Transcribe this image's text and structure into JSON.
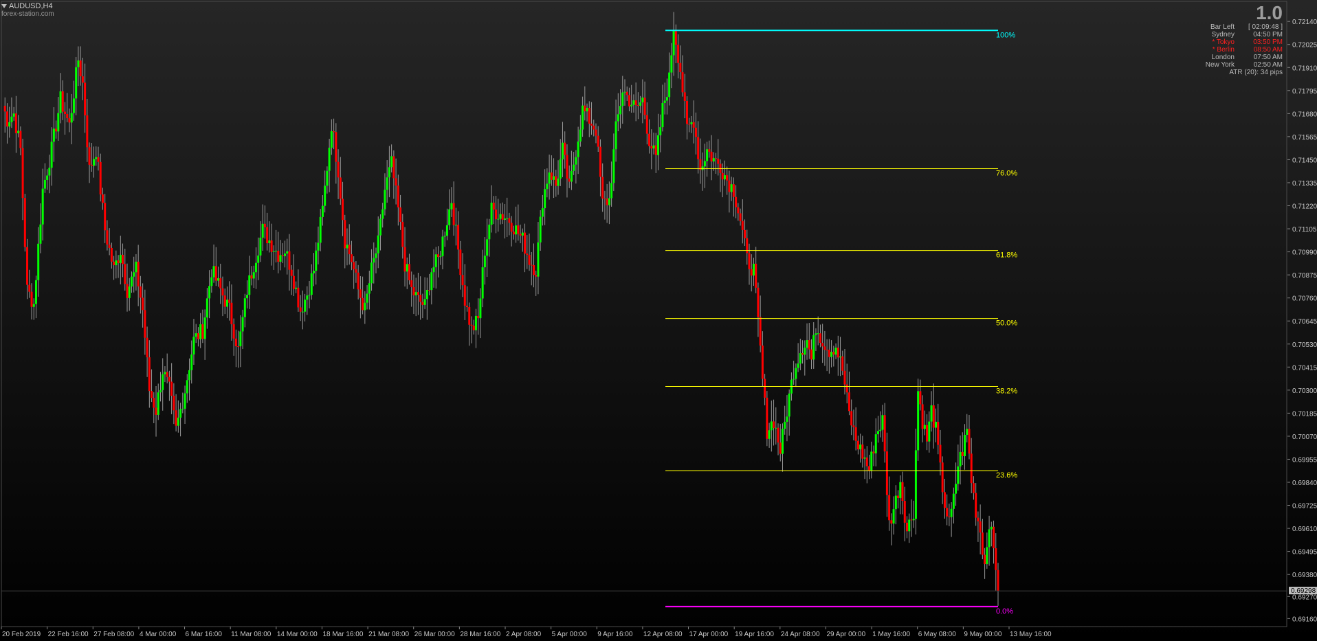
{
  "header": {
    "symbol": "AUDUSD,H4",
    "site": "forex-station.com"
  },
  "info_panel": {
    "big_value": "1.0",
    "rows": [
      {
        "name": "Bar Left",
        "value": "[ 02:09:48 ]",
        "highlight": false
      },
      {
        "name": "Sydney",
        "value": "04:50 PM",
        "highlight": false
      },
      {
        "name": "* Tokyo",
        "value": "03:50 PM",
        "highlight": true
      },
      {
        "name": "* Berlin",
        "value": "08:50 AM",
        "highlight": true
      },
      {
        "name": "London",
        "value": "07:50 AM",
        "highlight": false
      },
      {
        "name": "New York",
        "value": "02:50 AM",
        "highlight": false
      }
    ],
    "atr": "ATR (20): 34 pips"
  },
  "colors": {
    "bull": "#00ff00",
    "bear": "#ff0000",
    "wick": "#9a9a9a",
    "fib_top": "#00ffff",
    "fib_mid": "#ffff00",
    "fib_bottom": "#ff00ff",
    "axis_text": "#c8c8c8",
    "current_price_box": "#c0c0c0"
  },
  "chart_data": {
    "type": "candlestick",
    "symbol": "AUDUSD",
    "timeframe": "H4",
    "ylim": [
      0.6912,
      0.7224
    ],
    "y_ticks": [
      "0.72140",
      "0.72025",
      "0.71910",
      "0.71795",
      "0.71680",
      "0.71565",
      "0.71450",
      "0.71335",
      "0.71220",
      "0.71105",
      "0.70990",
      "0.70875",
      "0.70760",
      "0.70645",
      "0.70530",
      "0.70415",
      "0.70300",
      "0.70185",
      "0.70070",
      "0.69955",
      "0.69840",
      "0.69725",
      "0.69610",
      "0.69495",
      "0.69380",
      "0.69270",
      "0.69160"
    ],
    "x_ticks": [
      "20 Feb 2019",
      "22 Feb 16:00",
      "27 Feb 08:00",
      "4 Mar 00:00",
      "6 Mar 16:00",
      "11 Mar 08:00",
      "14 Mar 00:00",
      "18 Mar 16:00",
      "21 Mar 08:00",
      "26 Mar 00:00",
      "28 Mar 16:00",
      "2 Apr 08:00",
      "5 Apr 00:00",
      "9 Apr 16:00",
      "12 Apr 08:00",
      "17 Apr 00:00",
      "19 Apr 16:00",
      "24 Apr 08:00",
      "29 Apr 00:00",
      "1 May 16:00",
      "6 May 08:00",
      "9 May 00:00",
      "13 May 16:00"
    ],
    "current_price": "0.69298",
    "current_price_value": 0.69298,
    "waypoints": [
      [
        0,
        0.7172
      ],
      [
        2,
        0.7165
      ],
      [
        5,
        0.7168
      ],
      [
        8,
        0.715
      ],
      [
        11,
        0.708
      ],
      [
        14,
        0.7073
      ],
      [
        18,
        0.713
      ],
      [
        22,
        0.715
      ],
      [
        26,
        0.7175
      ],
      [
        30,
        0.7162
      ],
      [
        34,
        0.7195
      ],
      [
        36,
        0.7183
      ],
      [
        39,
        0.714
      ],
      [
        42,
        0.715
      ],
      [
        46,
        0.711
      ],
      [
        50,
        0.709
      ],
      [
        53,
        0.71
      ],
      [
        56,
        0.708
      ],
      [
        60,
        0.709
      ],
      [
        63,
        0.707
      ],
      [
        66,
        0.703
      ],
      [
        69,
        0.702
      ],
      [
        72,
        0.704
      ],
      [
        75,
        0.703
      ],
      [
        78,
        0.701
      ],
      [
        82,
        0.703
      ],
      [
        86,
        0.7055
      ],
      [
        90,
        0.706
      ],
      [
        94,
        0.709
      ],
      [
        98,
        0.708
      ],
      [
        102,
        0.707
      ],
      [
        106,
        0.705
      ],
      [
        110,
        0.708
      ],
      [
        113,
        0.7093
      ],
      [
        117,
        0.711
      ],
      [
        121,
        0.7103
      ],
      [
        124,
        0.7098
      ],
      [
        127,
        0.71
      ],
      [
        130,
        0.709
      ],
      [
        134,
        0.707
      ],
      [
        137,
        0.7078
      ],
      [
        140,
        0.709
      ],
      [
        144,
        0.712
      ],
      [
        148,
        0.7163
      ],
      [
        151,
        0.714
      ],
      [
        154,
        0.7105
      ],
      [
        157,
        0.7095
      ],
      [
        160,
        0.708
      ],
      [
        163,
        0.707
      ],
      [
        166,
        0.709
      ],
      [
        169,
        0.7103
      ],
      [
        172,
        0.713
      ],
      [
        175,
        0.7143
      ],
      [
        178,
        0.712
      ],
      [
        181,
        0.7093
      ],
      [
        184,
        0.708
      ],
      [
        187,
        0.7075
      ],
      [
        190,
        0.7072
      ],
      [
        193,
        0.709
      ],
      [
        196,
        0.7095
      ],
      [
        199,
        0.711
      ],
      [
        202,
        0.7125
      ],
      [
        205,
        0.71
      ],
      [
        208,
        0.7075
      ],
      [
        211,
        0.706
      ],
      [
        214,
        0.7065
      ],
      [
        217,
        0.71
      ],
      [
        220,
        0.712
      ],
      [
        224,
        0.7118
      ],
      [
        228,
        0.7115
      ],
      [
        231,
        0.711
      ],
      [
        234,
        0.7105
      ],
      [
        237,
        0.7095
      ],
      [
        240,
        0.709
      ],
      [
        243,
        0.7125
      ],
      [
        246,
        0.714
      ],
      [
        249,
        0.7132
      ],
      [
        252,
        0.715
      ],
      [
        255,
        0.713
      ],
      [
        258,
        0.715
      ],
      [
        261,
        0.717
      ],
      [
        264,
        0.7165
      ],
      [
        267,
        0.716
      ],
      [
        270,
        0.7123
      ],
      [
        273,
        0.7125
      ],
      [
        276,
        0.716
      ],
      [
        279,
        0.718
      ],
      [
        282,
        0.7175
      ],
      [
        285,
        0.717
      ],
      [
        288,
        0.7175
      ],
      [
        291,
        0.7155
      ],
      [
        294,
        0.7145
      ],
      [
        297,
        0.717
      ],
      [
        300,
        0.7185
      ],
      [
        302,
        0.7212
      ],
      [
        305,
        0.719
      ],
      [
        308,
        0.716
      ],
      [
        311,
        0.7165
      ],
      [
        314,
        0.714
      ],
      [
        317,
        0.715
      ],
      [
        320,
        0.7145
      ],
      [
        323,
        0.7142
      ],
      [
        326,
        0.7135
      ],
      [
        329,
        0.713
      ],
      [
        332,
        0.7115
      ],
      [
        335,
        0.7095
      ],
      [
        338,
        0.709
      ],
      [
        341,
        0.705
      ],
      [
        342,
        0.7035
      ],
      [
        344,
        0.701
      ],
      [
        347,
        0.7015
      ],
      [
        350,
        0.7
      ],
      [
        353,
        0.702
      ],
      [
        356,
        0.704
      ],
      [
        359,
        0.705
      ],
      [
        362,
        0.7055
      ],
      [
        364,
        0.7045
      ],
      [
        366,
        0.7062
      ],
      [
        369,
        0.7055
      ],
      [
        372,
        0.705
      ],
      [
        375,
        0.7052
      ],
      [
        378,
        0.704
      ],
      [
        381,
        0.7018
      ],
      [
        384,
        0.7005
      ],
      [
        387,
        0.6998
      ],
      [
        390,
        0.699
      ],
      [
        393,
        0.7008
      ],
      [
        396,
        0.7015
      ],
      [
        399,
        0.6963
      ],
      [
        402,
        0.6975
      ],
      [
        404,
        0.6985
      ],
      [
        407,
        0.696
      ],
      [
        410,
        0.697
      ],
      [
        412,
        0.703
      ],
      [
        414,
        0.7015
      ],
      [
        416,
        0.7005
      ],
      [
        418,
        0.702
      ],
      [
        420,
        0.701
      ],
      [
        422,
        0.699
      ],
      [
        424,
        0.6973
      ],
      [
        426,
        0.6963
      ],
      [
        428,
        0.6975
      ],
      [
        430,
        0.6993
      ],
      [
        432,
        0.7
      ],
      [
        434,
        0.701
      ],
      [
        436,
        0.6985
      ],
      [
        438,
        0.697
      ],
      [
        440,
        0.696
      ],
      [
        442,
        0.6943
      ],
      [
        444,
        0.6965
      ],
      [
        446,
        0.695
      ],
      [
        448,
        0.6935
      ]
    ],
    "fibonacci": {
      "high": 0.72095,
      "low": 0.6922,
      "levels": [
        {
          "label": "100%",
          "ratio": 1.0,
          "color": "#00ffff"
        },
        {
          "label": "76.0%",
          "ratio": 0.76,
          "color": "#ffff00"
        },
        {
          "label": "61.8%",
          "ratio": 0.618,
          "color": "#ffff00"
        },
        {
          "label": "50.0%",
          "ratio": 0.5,
          "color": "#ffff00"
        },
        {
          "label": "38.2%",
          "ratio": 0.382,
          "color": "#ffff00"
        },
        {
          "label": "23.6%",
          "ratio": 0.236,
          "color": "#ffff00"
        },
        {
          "label": "0.0%",
          "ratio": 0.0,
          "color": "#ff00ff"
        }
      ]
    }
  }
}
